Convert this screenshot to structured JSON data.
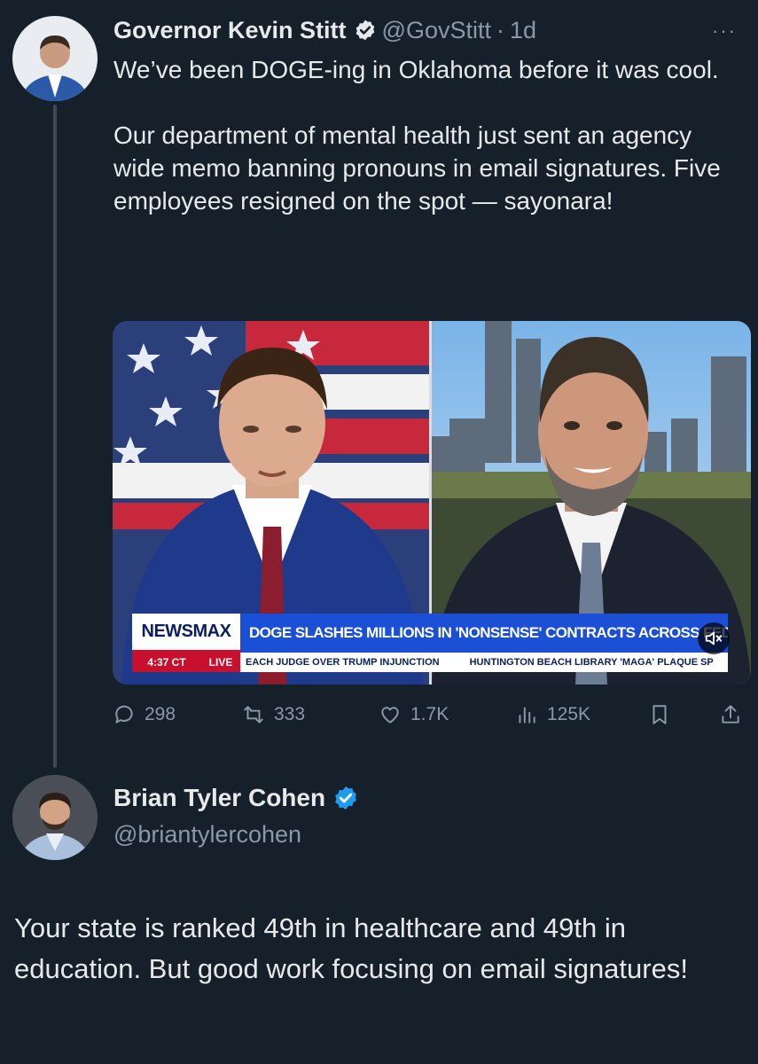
{
  "tweet": {
    "author_name": "Governor Kevin Stitt",
    "handle": "@GovStitt",
    "separator": "·",
    "time": "1d",
    "more_label": "···",
    "paragraphs": [
      "We’ve been DOGE-ing in Oklahoma before it was cool.",
      "Our department of mental health just sent an agency wide memo banning pronouns in email signatures. Five employees resigned on the spot — sayonara!"
    ],
    "media": {
      "brand": "NEWSMAX",
      "headline": "DOGE SLASHES MILLIONS IN 'NONSENSE' CONTRACTS ACROSS FEDERAL AGENCIES",
      "clock": "4:37 CT",
      "live": "LIVE",
      "ticker_1": "EACH JUDGE OVER TRUMP INJUNCTION",
      "ticker_2": "HUNTINGTON BEACH LIBRARY 'MAGA' PLAQUE SP",
      "mute_icon": "speaker-muted-icon"
    },
    "actions": {
      "replies": "298",
      "reposts": "333",
      "likes": "1.7K",
      "views": "125K"
    }
  },
  "reply": {
    "author_name": "Brian Tyler Cohen",
    "handle": "@briantylercohen",
    "text": "Your state is ranked 49th in healthcare and 49th in education. But good work focusing on email signatures!"
  },
  "colors": {
    "background": "#15202b",
    "text": "#e7e9ea",
    "muted": "#8b98a5",
    "verified": "#1d9bf0",
    "newsmax_blue": "#1a4fd6",
    "newsmax_red": "#c8102e"
  }
}
